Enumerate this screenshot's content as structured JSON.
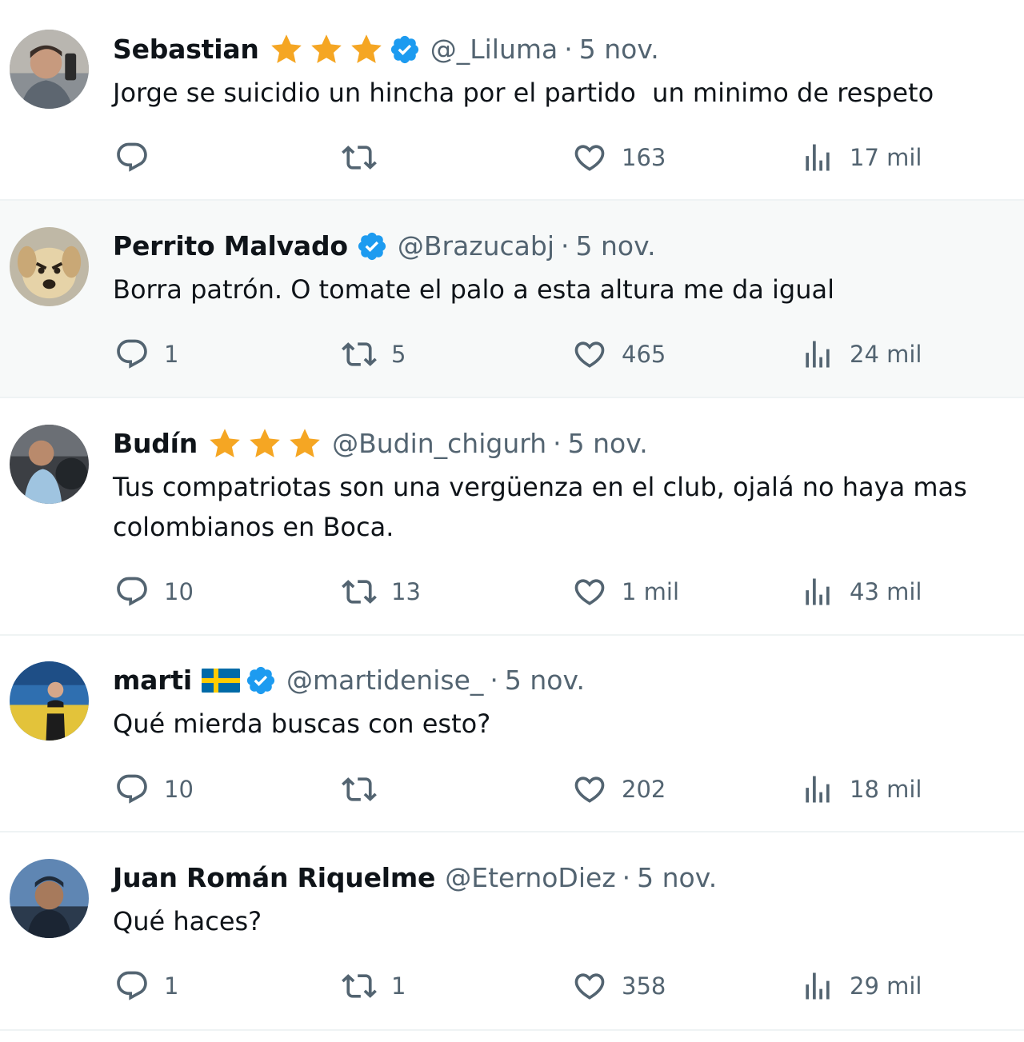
{
  "colors": {
    "verified_badge": "#1d9bf0",
    "star_gold": "#f5a623",
    "secondary_text": "#536471",
    "primary_text": "#0f1419"
  },
  "icons": {
    "reply": "reply-icon",
    "retweet": "retweet-icon",
    "like": "like-icon",
    "views": "views-icon",
    "verified": "verified-badge-icon",
    "star": "star-icon",
    "flag": "sweden-flag-icon"
  },
  "tweets": [
    {
      "name": "Sebastian",
      "stars": 3,
      "verified": true,
      "handle": "@_Liluma",
      "separator": "·",
      "time": "5 nov.",
      "text": "Jorge se suicidio un hincha por el partido  un minimo de respeto",
      "replies": "",
      "retweets": "",
      "likes": "163",
      "views": "17 mil"
    },
    {
      "name": "Perrito Malvado",
      "stars": 0,
      "verified": true,
      "handle": "@Brazucabj",
      "separator": "·",
      "time": "5 nov.",
      "text": "Borra patrón. O tomate el palo a esta altura me da igual",
      "replies": "1",
      "retweets": "5",
      "likes": "465",
      "views": "24 mil"
    },
    {
      "name": "Budín",
      "stars": 3,
      "verified": false,
      "handle": "@Budin_chigurh",
      "separator": "·",
      "time": "5 nov.",
      "text": "Tus compatriotas son una vergüenza en el club, ojalá no haya mas colombianos en Boca.",
      "replies": "10",
      "retweets": "13",
      "likes": "1 mil",
      "views": "43 mil"
    },
    {
      "name": "marti",
      "stars": 0,
      "flag": "sweden",
      "verified": true,
      "handle": "@martidenise_",
      "separator": "·",
      "time": "5 nov.",
      "text": "Qué mierda buscas con esto?",
      "replies": "10",
      "retweets": "",
      "likes": "202",
      "views": "18 mil"
    },
    {
      "name": "Juan Román Riquelme",
      "stars": 0,
      "verified": false,
      "handle": "@EternoDiez",
      "separator": "·",
      "time": "5 nov.",
      "text": "Qué haces?",
      "replies": "1",
      "retweets": "1",
      "likes": "358",
      "views": "29 mil"
    }
  ]
}
